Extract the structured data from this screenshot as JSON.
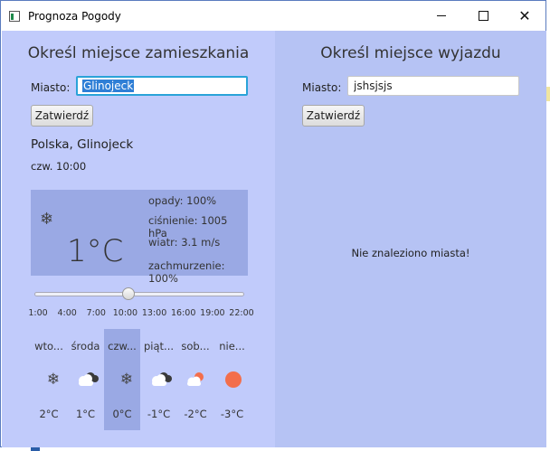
{
  "window": {
    "title": "Prognoza Pogody"
  },
  "left": {
    "title": "Określ miejsce zamieszkania",
    "city_label": "Miasto:",
    "city_value": "Glinojeck",
    "confirm_label": "Zatwierdź",
    "location": "Polska, Glinojeck",
    "time": "czw. 10:00",
    "current": {
      "temp": "1°C",
      "icon": "snowflake-icon",
      "opady": "opady: 100%",
      "cisnienie": "ciśnienie: 1005 hPa",
      "wiatr": "wiatr: 3.1 m/s",
      "zachmurzenie": "zachmurzenie: 100%"
    },
    "slider": {
      "ticks": [
        "1:00",
        "4:00",
        "7:00",
        "10:00",
        "13:00",
        "16:00",
        "19:00",
        "22:00"
      ],
      "value": 10,
      "min": 1,
      "max": 22
    },
    "days": [
      {
        "name": "wto...",
        "icon": "snowflake-icon",
        "temp": "2°C"
      },
      {
        "name": "środa",
        "icon": "cloud-dark-icon",
        "temp": "1°C"
      },
      {
        "name": "czw...",
        "icon": "snowflake-icon",
        "temp": "0°C",
        "active": true
      },
      {
        "name": "piąt...",
        "icon": "cloud-dark-icon",
        "temp": "-1°C"
      },
      {
        "name": "sob...",
        "icon": "sun-cloud-icon",
        "temp": "-2°C"
      },
      {
        "name": "nie...",
        "icon": "sun-icon",
        "temp": "-3°C"
      }
    ]
  },
  "right": {
    "title": "Określ miejsce wyjazdu",
    "city_label": "Miasto:",
    "city_value": "jshsjsjs",
    "confirm_label": "Zatwierdź",
    "message": "Nie znaleziono miasta!"
  },
  "colors": {
    "left_panel": "#c1cbfb",
    "right_panel": "#b6c3f4",
    "highlight": "#9aa9e4",
    "sun": "#f36e4b"
  }
}
